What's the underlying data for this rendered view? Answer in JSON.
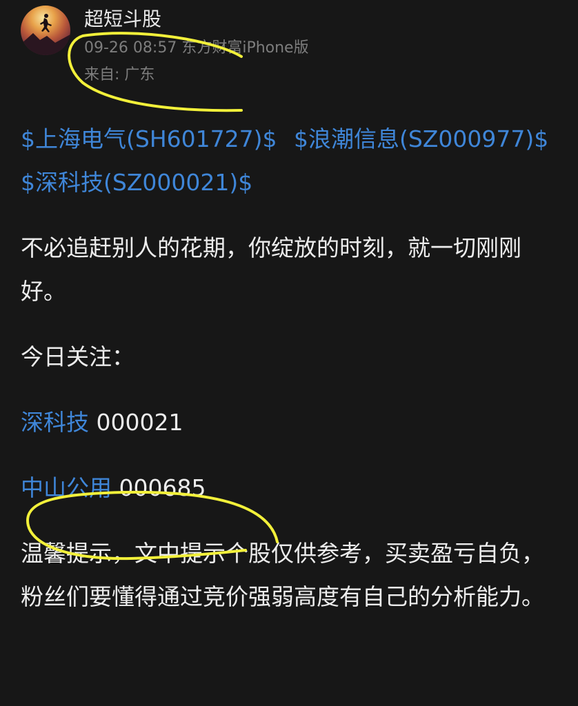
{
  "post": {
    "author": "超短斗股",
    "time": "09-26 08:57",
    "source": "东方财富iPhone版",
    "location": "来自: 广东"
  },
  "stock_tags": [
    "$上海电气(SH601727)$",
    "$浪潮信息(SZ000977)$",
    "$深科技(SZ000021)$"
  ],
  "body": {
    "quote": "不必追赶别人的花期，你绽放的时刻，就一切刚刚好。",
    "focus_label": "今日关注：",
    "picks": [
      {
        "name": "深科技",
        "code": "000021"
      },
      {
        "name": "中山公用",
        "code": "000685"
      }
    ],
    "disclaimer": "温馨提示，文中提示个股仅供参考，买卖盈亏自负，粉丝们要懂得通过竞价强弱高度有自己的分析能力。"
  },
  "colors": {
    "background": "#171717",
    "link": "#3f86d8",
    "text": "#ececec",
    "meta": "#7d7d7d",
    "annotation": "#f2f03a"
  }
}
